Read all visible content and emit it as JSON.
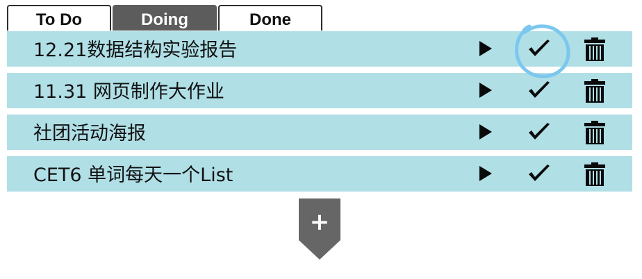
{
  "tabs": [
    {
      "label": "To Do",
      "active": false
    },
    {
      "label": "Doing",
      "active": true
    },
    {
      "label": "Done",
      "active": false
    }
  ],
  "tasks": [
    {
      "text": "12.21数据结构实验报告"
    },
    {
      "text": "11.31 网页制作大作业"
    },
    {
      "text": "社团活动海报"
    },
    {
      "text": "CET6 单词每天一个List"
    }
  ],
  "icons": {
    "start": "play-icon",
    "complete": "checkmark-icon",
    "delete": "trash-icon",
    "add": "plus-icon"
  },
  "add_button": {
    "label": "+"
  },
  "colors": {
    "row_background": "#b0dfe6",
    "active_tab": "#5c5c5c",
    "add_button": "#666666",
    "highlight_circle": "#7cc7ee"
  }
}
